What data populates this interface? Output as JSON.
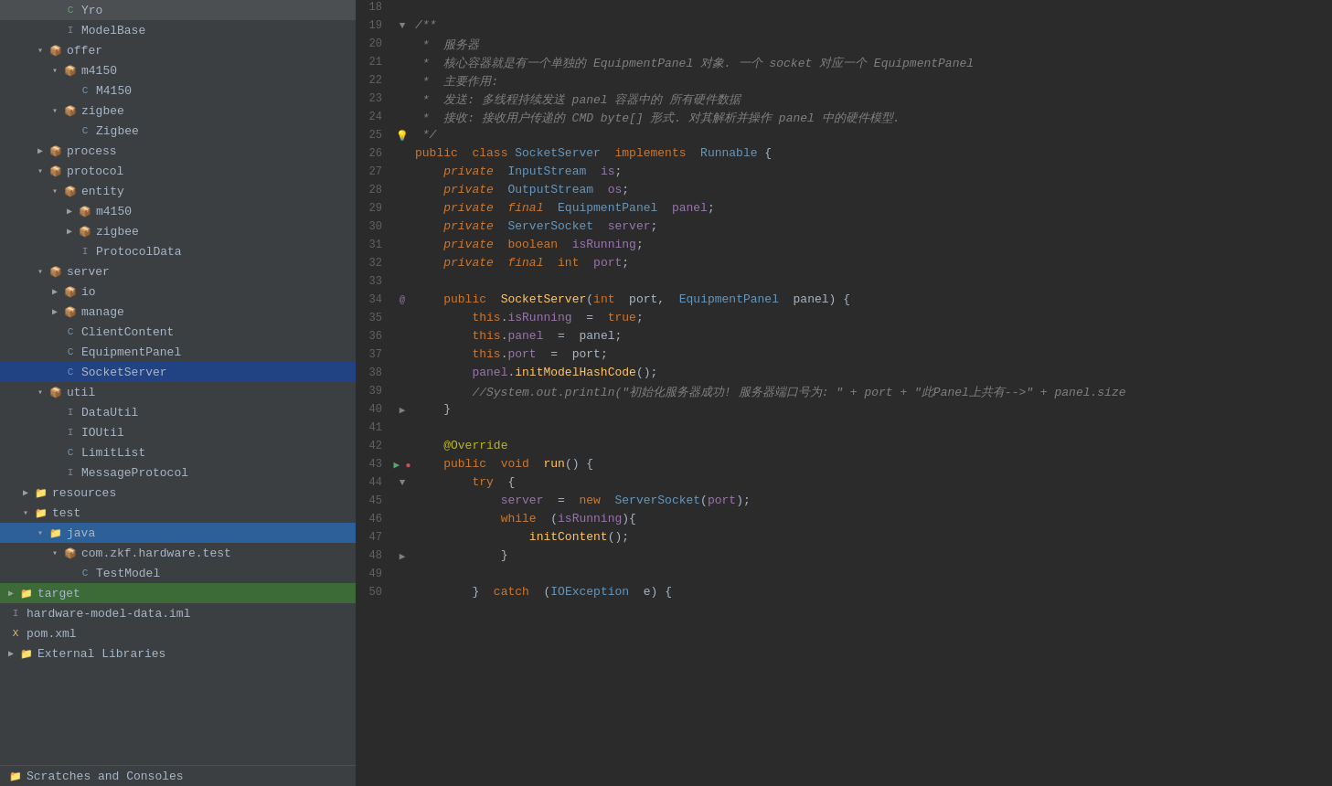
{
  "sidebar": {
    "items": [
      {
        "id": "yro",
        "label": "Yro",
        "level": 3,
        "type": "class-g",
        "indent": 3,
        "arrow": ""
      },
      {
        "id": "modelbase",
        "label": "ModelBase",
        "level": 3,
        "type": "interface",
        "indent": 3,
        "arrow": ""
      },
      {
        "id": "offer",
        "label": "offer",
        "level": 2,
        "type": "package",
        "indent": 2,
        "arrow": "▾",
        "open": true
      },
      {
        "id": "m4150-pkg",
        "label": "m4150",
        "level": 3,
        "type": "package",
        "indent": 3,
        "arrow": "▾",
        "open": true
      },
      {
        "id": "m4150-cls",
        "label": "M4150",
        "level": 4,
        "type": "class-c",
        "indent": 4,
        "arrow": ""
      },
      {
        "id": "zigbee-pkg",
        "label": "zigbee",
        "level": 3,
        "type": "package",
        "indent": 3,
        "arrow": "▾",
        "open": true
      },
      {
        "id": "zigbee-cls",
        "label": "Zigbee",
        "level": 4,
        "type": "class-c",
        "indent": 4,
        "arrow": ""
      },
      {
        "id": "process",
        "label": "process",
        "level": 2,
        "type": "package",
        "indent": 2,
        "arrow": "▶",
        "open": false
      },
      {
        "id": "protocol",
        "label": "protocol",
        "level": 2,
        "type": "package",
        "indent": 2,
        "arrow": "▾",
        "open": true
      },
      {
        "id": "entity",
        "label": "entity",
        "level": 3,
        "type": "package",
        "indent": 3,
        "arrow": "▾",
        "open": true
      },
      {
        "id": "entity-m4150",
        "label": "m4150",
        "level": 4,
        "type": "package",
        "indent": 4,
        "arrow": "▶",
        "open": false
      },
      {
        "id": "entity-zigbee",
        "label": "zigbee",
        "level": 4,
        "type": "package",
        "indent": 4,
        "arrow": "▶",
        "open": false
      },
      {
        "id": "protocoldata",
        "label": "ProtocolData",
        "level": 4,
        "type": "interface",
        "indent": 4,
        "arrow": ""
      },
      {
        "id": "server",
        "label": "server",
        "level": 2,
        "type": "package",
        "indent": 2,
        "arrow": "▾",
        "open": true
      },
      {
        "id": "io",
        "label": "io",
        "level": 3,
        "type": "package",
        "indent": 3,
        "arrow": "▶",
        "open": false
      },
      {
        "id": "manage",
        "label": "manage",
        "level": 3,
        "type": "package",
        "indent": 3,
        "arrow": "▶",
        "open": false
      },
      {
        "id": "clientcontent",
        "label": "ClientContent",
        "level": 3,
        "type": "class-c",
        "indent": 3,
        "arrow": ""
      },
      {
        "id": "equipmentpanel",
        "label": "EquipmentPanel",
        "level": 3,
        "type": "class-c",
        "indent": 3,
        "arrow": ""
      },
      {
        "id": "socketserver",
        "label": "SocketServer",
        "level": 3,
        "type": "class-c",
        "indent": 3,
        "arrow": "",
        "selected": true
      },
      {
        "id": "util",
        "label": "util",
        "level": 2,
        "type": "package",
        "indent": 2,
        "arrow": "▾",
        "open": true
      },
      {
        "id": "datautil",
        "label": "DataUtil",
        "level": 3,
        "type": "interface",
        "indent": 3,
        "arrow": ""
      },
      {
        "id": "ioutil",
        "label": "IOUtil",
        "level": 3,
        "type": "interface",
        "indent": 3,
        "arrow": ""
      },
      {
        "id": "limitlist",
        "label": "LimitList",
        "level": 3,
        "type": "class-c",
        "indent": 3,
        "arrow": ""
      },
      {
        "id": "messageprotocol",
        "label": "MessageProtocol",
        "level": 3,
        "type": "interface",
        "indent": 3,
        "arrow": ""
      },
      {
        "id": "resources",
        "label": "resources",
        "level": 1,
        "type": "folder",
        "indent": 1,
        "arrow": "▶",
        "open": false
      },
      {
        "id": "test",
        "label": "test",
        "level": 1,
        "type": "folder",
        "indent": 1,
        "arrow": "▾",
        "open": true
      },
      {
        "id": "java",
        "label": "java",
        "level": 2,
        "type": "folder",
        "indent": 2,
        "arrow": "▾",
        "open": true,
        "highlighted": true
      },
      {
        "id": "com-zkf-hardware-test",
        "label": "com.zkf.hardware.test",
        "level": 3,
        "type": "package",
        "indent": 3,
        "arrow": "▾",
        "open": true
      },
      {
        "id": "testmodel",
        "label": "TestModel",
        "level": 4,
        "type": "class-c",
        "indent": 4,
        "arrow": ""
      },
      {
        "id": "target",
        "label": "target",
        "level": 0,
        "type": "folder",
        "indent": 0,
        "arrow": "▶",
        "open": false,
        "highlighted2": true
      }
    ],
    "bottom_items": [
      {
        "id": "hardware-model-data",
        "label": "hardware-model-data.iml",
        "type": "file"
      },
      {
        "id": "pom-xml",
        "label": "pom.xml",
        "type": "xml"
      },
      {
        "id": "external-libraries",
        "label": "External Libraries",
        "type": "folder"
      },
      {
        "id": "scratches",
        "label": "Scratches and Consoles",
        "type": "folder"
      }
    ]
  },
  "editor": {
    "lines": [
      {
        "num": 18,
        "gutter": "",
        "content": ""
      },
      {
        "num": 19,
        "gutter": "fold",
        "content": "/**"
      },
      {
        "num": 20,
        "gutter": "",
        "content": " *  服务器"
      },
      {
        "num": 21,
        "gutter": "",
        "content": " *  核心容器就是有一个单独的 EquipmentPanel 对象. 一个 socket 对应一个 EquipmentPanel"
      },
      {
        "num": 22,
        "gutter": "",
        "content": " *  主要作用:"
      },
      {
        "num": 23,
        "gutter": "",
        "content": " *  发送: 多线程持续发送 panel 容器中的 所有硬件数据"
      },
      {
        "num": 24,
        "gutter": "",
        "content": " *  接收: 接收用户传递的 CMD byte[] 形式. 对其解析并操作 panel 中的硬件模型."
      },
      {
        "num": 25,
        "gutter": "bulb",
        "content": " */"
      },
      {
        "num": 26,
        "gutter": "",
        "content": "public  class SocketServer  implements  Runnable {"
      },
      {
        "num": 27,
        "gutter": "",
        "content": "    private  InputStream  is;"
      },
      {
        "num": 28,
        "gutter": "",
        "content": "    private  OutputStream  os;"
      },
      {
        "num": 29,
        "gutter": "",
        "content": "    private  final  EquipmentPanel  panel;"
      },
      {
        "num": 30,
        "gutter": "",
        "content": "    private  ServerSocket  server;"
      },
      {
        "num": 31,
        "gutter": "",
        "content": "    private  boolean  isRunning;"
      },
      {
        "num": 32,
        "gutter": "",
        "content": "    private  final  int  port;"
      },
      {
        "num": 33,
        "gutter": "",
        "content": ""
      },
      {
        "num": 34,
        "gutter": "annot",
        "content": "    public  SocketServer(int  port,  EquipmentPanel  panel)  {"
      },
      {
        "num": 35,
        "gutter": "",
        "content": "        this.isRunning  =  true;"
      },
      {
        "num": 36,
        "gutter": "",
        "content": "        this.panel  =  panel;"
      },
      {
        "num": 37,
        "gutter": "",
        "content": "        this.port  =  port;"
      },
      {
        "num": 38,
        "gutter": "",
        "content": "        panel.initModelHashCode();"
      },
      {
        "num": 39,
        "gutter": "",
        "content": "        //System.out.println(\"初始化服务器成功! 服务器端口号为: \" + port + \"此Panel上共有-->\" + panel.size"
      },
      {
        "num": 40,
        "gutter": "fold",
        "content": "    }"
      },
      {
        "num": 41,
        "gutter": "",
        "content": ""
      },
      {
        "num": 42,
        "gutter": "",
        "content": "    @Override"
      },
      {
        "num": 43,
        "gutter": "debug",
        "content": "    public  void  run()  {"
      },
      {
        "num": 44,
        "gutter": "fold",
        "content": "        try  {"
      },
      {
        "num": 45,
        "gutter": "",
        "content": "            server  =  new  ServerSocket(port);"
      },
      {
        "num": 46,
        "gutter": "",
        "content": "            while  (isRunning){"
      },
      {
        "num": 47,
        "gutter": "",
        "content": "                initContent();"
      },
      {
        "num": 48,
        "gutter": "fold",
        "content": "            }"
      },
      {
        "num": 49,
        "gutter": "",
        "content": ""
      },
      {
        "num": 50,
        "gutter": "",
        "content": "        }  catch  (IOException  e)  {"
      }
    ]
  }
}
